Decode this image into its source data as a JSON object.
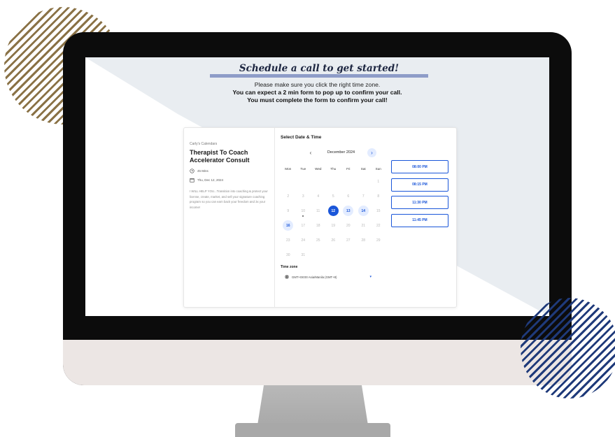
{
  "page": {
    "heading": "Schedule a call to get started!",
    "note_line1": "Please make sure you click the right time zone.",
    "note_line2": "You can expect a 2 min form to pop up to confirm your call.",
    "note_line3": "You must complete the form to confirm your call!"
  },
  "event": {
    "owner": "Carly's Calendars",
    "title": "Therapist To Coach Accelerator Consult",
    "duration": "45 Mins",
    "date": "Thu, Dec 12, 2024",
    "description": "I WILL HELP YOU...Transition into coaching & protect your license, create, market, and sell your signature coaching program so you can earn back your freedom and 3x your income!"
  },
  "scheduler": {
    "title": "Select Date & Time",
    "month": "December 2024",
    "weekdays": [
      "Mon",
      "Tue",
      "Wed",
      "Thu",
      "Fri",
      "Sat",
      "Sun"
    ],
    "days": [
      {
        "label": "1",
        "col": 7,
        "state": "unavailable"
      },
      {
        "label": "2",
        "col": 1,
        "state": "unavailable"
      },
      {
        "label": "3",
        "col": 2,
        "state": "unavailable"
      },
      {
        "label": "4",
        "col": 3,
        "state": "unavailable"
      },
      {
        "label": "5",
        "col": 4,
        "state": "unavailable"
      },
      {
        "label": "6",
        "col": 5,
        "state": "unavailable"
      },
      {
        "label": "7",
        "col": 6,
        "state": "unavailable"
      },
      {
        "label": "8",
        "col": 7,
        "state": "unavailable"
      },
      {
        "label": "9",
        "col": 1,
        "state": "unavailable"
      },
      {
        "label": "10",
        "col": 2,
        "state": "unavailable",
        "today": true
      },
      {
        "label": "11",
        "col": 3,
        "state": "unavailable"
      },
      {
        "label": "12",
        "col": 4,
        "state": "selected"
      },
      {
        "label": "13",
        "col": 5,
        "state": "available"
      },
      {
        "label": "14",
        "col": 6,
        "state": "available"
      },
      {
        "label": "15",
        "col": 7,
        "state": "unavailable"
      },
      {
        "label": "16",
        "col": 1,
        "state": "available"
      },
      {
        "label": "17",
        "col": 2,
        "state": "unavailable"
      },
      {
        "label": "18",
        "col": 3,
        "state": "unavailable"
      },
      {
        "label": "19",
        "col": 4,
        "state": "unavailable"
      },
      {
        "label": "20",
        "col": 5,
        "state": "unavailable"
      },
      {
        "label": "21",
        "col": 6,
        "state": "unavailable"
      },
      {
        "label": "22",
        "col": 7,
        "state": "unavailable"
      },
      {
        "label": "23",
        "col": 1,
        "state": "unavailable"
      },
      {
        "label": "24",
        "col": 2,
        "state": "unavailable"
      },
      {
        "label": "25",
        "col": 3,
        "state": "unavailable"
      },
      {
        "label": "26",
        "col": 4,
        "state": "unavailable"
      },
      {
        "label": "27",
        "col": 5,
        "state": "unavailable"
      },
      {
        "label": "28",
        "col": 6,
        "state": "unavailable"
      },
      {
        "label": "29",
        "col": 7,
        "state": "unavailable"
      },
      {
        "label": "30",
        "col": 1,
        "state": "unavailable"
      },
      {
        "label": "31",
        "col": 2,
        "state": "unavailable"
      }
    ],
    "time_slots": [
      "08:00 PM",
      "08:15 PM",
      "11:30 PM",
      "11:45 PM"
    ],
    "timezone_label": "Time zone",
    "timezone_value": "GMT+08:00 Asia/Manila (GMT+8)"
  },
  "colors": {
    "accent": "#1a56d9",
    "accent_light": "#e3ecff",
    "heading_bar": "#8e9cc8",
    "deco_gold": "#8a7246",
    "deco_navy": "#1f3a7a"
  },
  "icons": {
    "clock": "clock-icon",
    "calendar": "calendar-icon",
    "globe": "globe-icon",
    "chevron_left": "chevron-left-icon",
    "chevron_right": "chevron-right-icon"
  }
}
